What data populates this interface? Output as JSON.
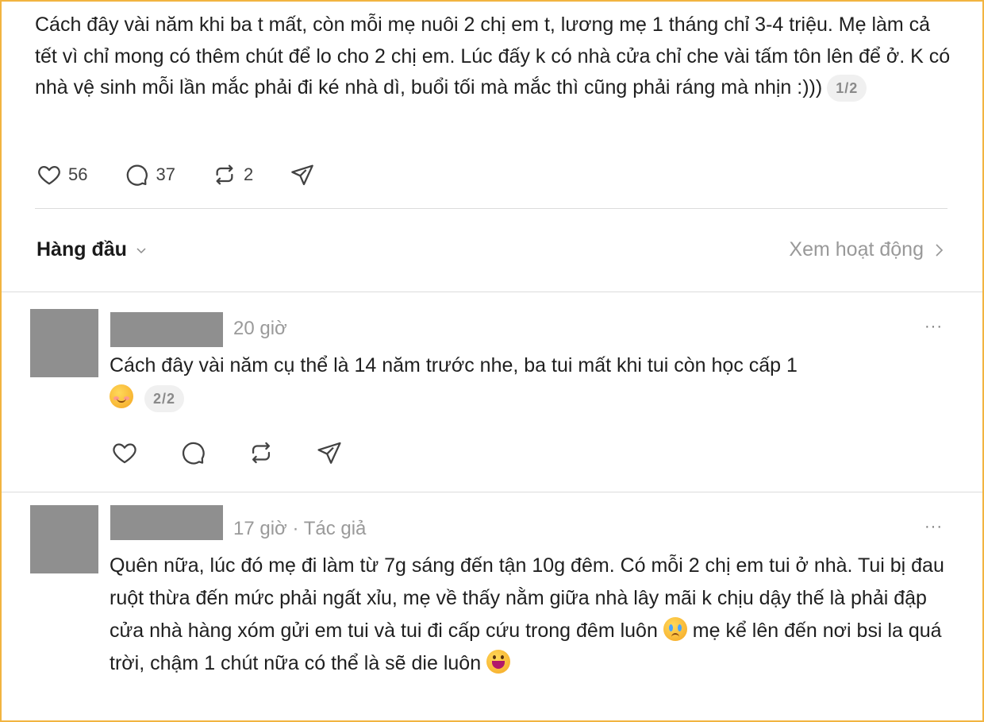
{
  "post": {
    "text": "Cách đây vài năm khi ba t mất, còn mỗi mẹ nuôi 2 chị em t, lương mẹ 1 tháng chỉ 3-4 triệu. Mẹ làm cả tết vì chỉ mong có thêm chút để lo cho 2 chị em. Lúc đấy k có nhà cửa chỉ che vài tấm tôn lên để ở. K có nhà vệ sinh mỗi lần mắc phải đi ké nhà dì, buổi tối mà mắc thì cũng phải ráng mà nhịn :)))",
    "pager": "1/2",
    "likes": "56",
    "comments": "37",
    "reposts": "2"
  },
  "sort": {
    "label": "Hàng đầu",
    "activity_link": "Xem hoạt động"
  },
  "replies": [
    {
      "time": "20 giờ",
      "text": "Cách đây vài năm cụ thể là 14 năm trước nhe, ba tui mất khi tui còn học cấp 1",
      "pager": "2/2",
      "more": "···"
    },
    {
      "time": "17 giờ",
      "author_tag": "Tác giả",
      "separator": "·",
      "text_a": "Quên nữa, lúc đó mẹ đi làm từ 7g sáng đến tận 10g đêm. Có mỗi 2 chị em tui ở nhà. Tui bị đau ruột thừa đến mức phải ngất xỉu, mẹ về thấy nằm giữa nhà lây mãi k chịu dậy thế là phải đập cửa nhà hàng xóm gửi em tui và tui đi cấp cứu trong đêm luôn",
      "text_b": "mẹ kể lên đến nơi bsi la quá trời, chậm 1 chút nữa có thể là sẽ die luôn",
      "more": "···"
    }
  ],
  "colors": {
    "frame": "#f2b440",
    "muted": "#999999",
    "avatar": "#8f8f8f"
  }
}
